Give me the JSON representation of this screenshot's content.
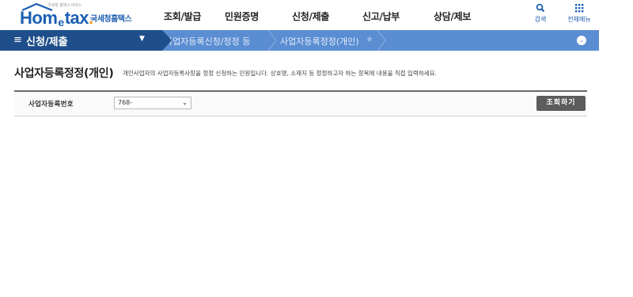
{
  "header": {
    "logo": {
      "tagline": "국세청 홈택스서비스",
      "brand": "Hometax",
      "brand_sub": "국세청홈택스"
    },
    "menu": [
      "조회/발급",
      "민원증명",
      "신청/제출",
      "신고/납부",
      "상담/제보"
    ],
    "search_label": "검색",
    "allmenu_label": "전체메뉴",
    "search_icon": "search-icon",
    "allmenu_icon": "grid-icon"
  },
  "nav": {
    "title": "신청/제출",
    "breadcrumbs": [
      "사업자등록신청/정정 등",
      "사업자등록정정(개인)"
    ]
  },
  "page": {
    "title": "사업자등록정정(개인)",
    "description": "개인사업자의 사업자등록사항을 정정 신청하는 민원입니다. 상호명, 소재지 등 정정하고자 하는 항목에 내용을 직접 입력하세요."
  },
  "search": {
    "label": "사업자등록번호",
    "selected_value": "768-",
    "button_label": "조회하기"
  },
  "colors": {
    "brand_blue": "#1b5fb2",
    "nav_dark": "#1e4f8a",
    "nav_light": "#5b8dd2",
    "button": "#5c5c5c"
  }
}
